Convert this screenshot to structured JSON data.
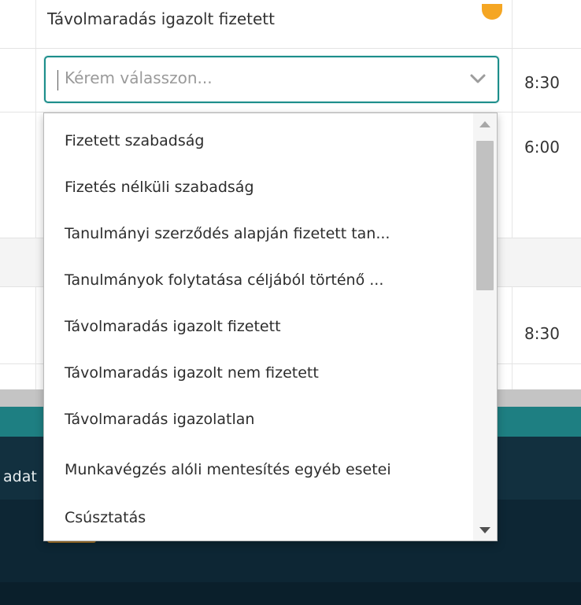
{
  "rows": {
    "top_row_text": "Távolmaradás igazolt fizetett",
    "time_1": "8:30",
    "time_2": "6:00",
    "time_3": "8:30"
  },
  "select": {
    "placeholder": "Kérem válasszon..."
  },
  "dropdown": {
    "options": [
      "Fizetett szabadság",
      "Fizetés nélküli szabadság",
      "Tanulmányi szerződés alapján fizetett tan...",
      "Tanulmányok folytatása céljából történő ...",
      "Távolmaradás igazolt fizetett",
      "Távolmaradás igazolt nem fizetett",
      "Távolmaradás igazolatlan",
      "Munkavégzés alóli mentesítés egyéb esetei",
      "Csúsztatás"
    ]
  },
  "footer": {
    "label_fragment": "adat"
  },
  "colors": {
    "accent": "#1c8e8b",
    "teal_bar": "#1e7f82",
    "navy": "#12303f",
    "orange": "#f5a623"
  }
}
